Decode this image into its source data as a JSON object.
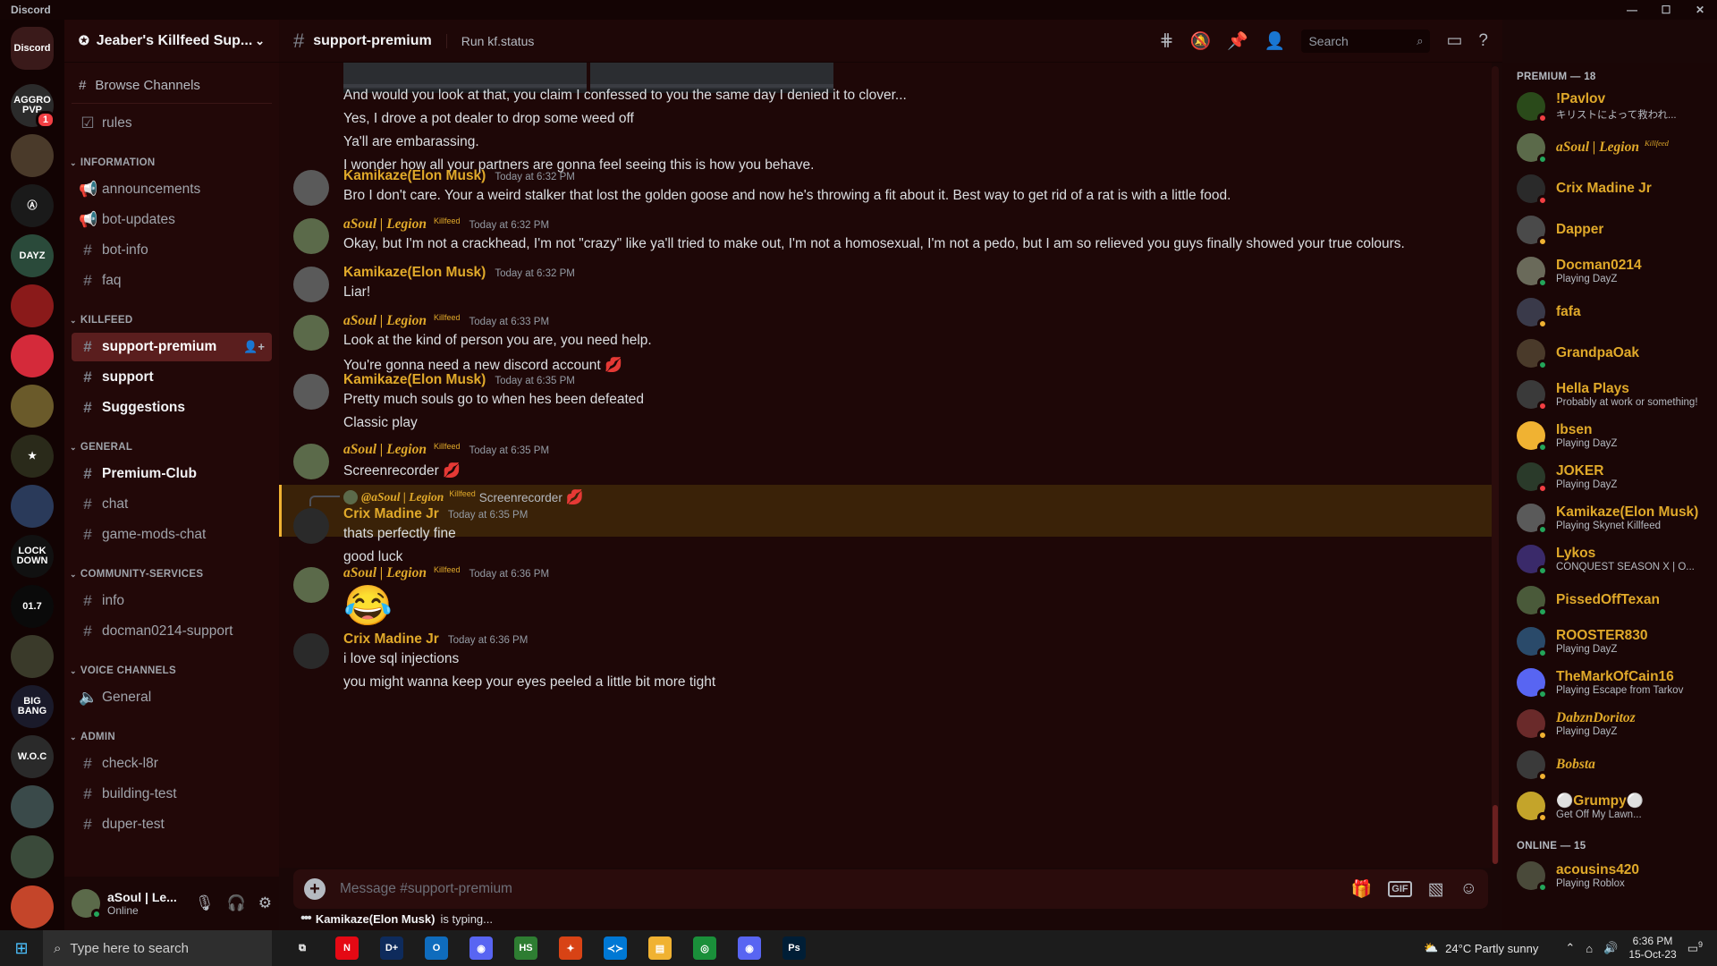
{
  "window": {
    "title": "Discord",
    "controls": [
      "—",
      "☐",
      "✕"
    ]
  },
  "servers": [
    {
      "label": "Discord",
      "color": "#3a1a1a"
    },
    {
      "label": "AGGRO PVP",
      "color": "#2b2b2b",
      "badge": "1"
    },
    {
      "label": "",
      "color": "#4a3a2a"
    },
    {
      "label": "Ⓐ",
      "color": "#1a1a1a"
    },
    {
      "label": "DAYZ",
      "color": "#2a4a3a"
    },
    {
      "label": "",
      "color": "#8a1a1a"
    },
    {
      "label": "",
      "color": "#d42a3a"
    },
    {
      "label": "",
      "color": "#6a5a2a"
    },
    {
      "label": "★",
      "color": "#2a2a1a"
    },
    {
      "label": "",
      "color": "#2a3a5a"
    },
    {
      "label": "LOCK DOWN",
      "color": "#111111"
    },
    {
      "label": "01.7",
      "color": "#0a0a0a"
    },
    {
      "label": "",
      "color": "#3a3a2a"
    },
    {
      "label": "BIG BANG",
      "color": "#1a1a2a"
    },
    {
      "label": "W.O.C",
      "color": "#2a2a2a"
    },
    {
      "label": "",
      "color": "#3a4a4a"
    },
    {
      "label": "",
      "color": "#3a4a3a"
    },
    {
      "label": "",
      "color": "#c4452a"
    }
  ],
  "server": {
    "name": "Jeaber's Killfeed Sup...",
    "browse": "Browse Channels"
  },
  "channels": {
    "top": [
      {
        "name": "rules",
        "icon": "☑"
      }
    ],
    "categories": [
      {
        "name": "INFORMATION",
        "items": [
          {
            "name": "announcements",
            "icon": "📢",
            "state": "normal"
          },
          {
            "name": "bot-updates",
            "icon": "📢",
            "state": "normal"
          },
          {
            "name": "bot-info",
            "icon": "#",
            "state": "normal"
          },
          {
            "name": "faq",
            "icon": "#",
            "state": "normal"
          }
        ]
      },
      {
        "name": "KILLFEED",
        "items": [
          {
            "name": "support-premium",
            "icon": "#",
            "state": "active"
          },
          {
            "name": "support",
            "icon": "#",
            "state": "unread"
          },
          {
            "name": "Suggestions",
            "icon": "#",
            "state": "unread"
          }
        ]
      },
      {
        "name": "GENERAL",
        "items": [
          {
            "name": "Premium-Club",
            "icon": "#",
            "state": "unread"
          },
          {
            "name": "chat",
            "icon": "#",
            "state": "normal"
          },
          {
            "name": "game-mods-chat",
            "icon": "#",
            "state": "normal"
          }
        ]
      },
      {
        "name": "COMMUNITY-SERVICES",
        "items": [
          {
            "name": "info",
            "icon": "#",
            "state": "normal"
          },
          {
            "name": "docman0214-support",
            "icon": "#",
            "state": "normal"
          }
        ]
      },
      {
        "name": "VOICE CHANNELS",
        "items": [
          {
            "name": "General",
            "icon": "🔈",
            "state": "normal"
          }
        ]
      },
      {
        "name": "ADMIN",
        "items": [
          {
            "name": "check-l8r",
            "icon": "#",
            "state": "normal"
          },
          {
            "name": "building-test",
            "icon": "#",
            "state": "normal"
          },
          {
            "name": "duper-test",
            "icon": "#",
            "state": "normal"
          }
        ]
      }
    ]
  },
  "user": {
    "name": "aSoul | Le...",
    "status": "Online"
  },
  "header": {
    "channel": "support-premium",
    "topic": "Run kf.status",
    "search_placeholder": "Search"
  },
  "messages": [
    {
      "type": "cont",
      "lines": [
        "And would you look at that, you claim I confessed to you the same day I denied it to clover...",
        "Yes, I drove a pot dealer to drop some weed off",
        "Ya'll are embarassing.",
        "I wonder how all your partners are gonna feel seeing this is how you behave."
      ]
    },
    {
      "type": "msg",
      "user": "Kamikaze(Elon Musk)",
      "tag": "",
      "time": "Today at 6:32 PM",
      "lines": [
        "Bro I don't care. Your a weird stalker that lost the golden goose and now he's throwing a fit about it. Best way to get rid of a rat is with a little food."
      ]
    },
    {
      "type": "msg",
      "user": "aSoul | Legion",
      "tag": "Killfeed",
      "time": "Today at 6:32 PM",
      "lines": [
        "Okay, but I'm not a crackhead, I'm not \"crazy\" like ya'll tried to make out, I'm not a homosexual, I'm not a pedo, but I am so relieved you guys finally showed your true colours."
      ]
    },
    {
      "type": "msg",
      "user": "Kamikaze(Elon Musk)",
      "tag": "",
      "time": "Today at 6:32 PM",
      "lines": [
        "Liar!"
      ]
    },
    {
      "type": "msg",
      "user": "aSoul | Legion",
      "tag": "Killfeed",
      "time": "Today at 6:33 PM",
      "lines": [
        "Look at the kind of person you are, you need help.",
        "You're gonna need a new discord account"
      ]
    },
    {
      "type": "msg",
      "user": "Kamikaze(Elon Musk)",
      "tag": "",
      "time": "Today at 6:35 PM",
      "lines": [
        "Pretty much souls go to when hes been defeated",
        "Classic play"
      ]
    },
    {
      "type": "msg",
      "user": "aSoul | Legion",
      "tag": "Killfeed",
      "time": "Today at 6:35 PM",
      "lines": [
        "Screenrecorder"
      ]
    },
    {
      "type": "reply",
      "reply_user": "@aSoul | Legion",
      "reply_tag": "Killfeed",
      "reply_text": "Screenrecorder",
      "user": "Crix Madine Jr",
      "time": "Today at 6:35 PM",
      "lines": [
        "thats perfectly fine",
        "good luck"
      ]
    },
    {
      "type": "msg",
      "user": "aSoul | Legion",
      "tag": "Killfeed",
      "time": "Today at 6:36 PM",
      "lines": [
        "😂"
      ]
    },
    {
      "type": "msg",
      "user": "Crix Madine Jr",
      "tag": "",
      "time": "Today at 6:36 PM",
      "lines": [
        "i love sql injections",
        "you might wanna keep your eyes peeled a little bit more tight"
      ]
    }
  ],
  "composer": {
    "placeholder": "Message #support-premium",
    "gif": "GIF"
  },
  "typing": {
    "user": "Kamikaze(Elon Musk)",
    "text": "is typing..."
  },
  "members": {
    "premium_header": "PREMIUM — 18",
    "online_header": "ONLINE — 15",
    "premium": [
      {
        "name": "!Pavlov",
        "activity": "キリストによって救われ...",
        "status": "dnd",
        "color": "#2a4a1a"
      },
      {
        "name": "aSoul | Legion",
        "tag": "Killfeed",
        "activity": "",
        "status": "online",
        "color": "#5b6a4a"
      },
      {
        "name": "Crix Madine Jr",
        "activity": "",
        "status": "dnd",
        "color": "#2a2a2a"
      },
      {
        "name": "Dapper",
        "activity": "",
        "status": "idle",
        "color": "#4a4a4a"
      },
      {
        "name": "Docman0214",
        "activity": "Playing DayZ",
        "status": "online",
        "color": "#6a6a5a"
      },
      {
        "name": "fafa",
        "activity": "",
        "status": "idle",
        "color": "#3a3a4a"
      },
      {
        "name": "GrandpaOak",
        "activity": "",
        "status": "online",
        "color": "#4a3a2a"
      },
      {
        "name": "Hella Plays",
        "activity": "Probably at work or something!",
        "status": "dnd",
        "color": "#3a3a3a"
      },
      {
        "name": "Ibsen",
        "activity": "Playing DayZ",
        "status": "online",
        "color": "#f0b232"
      },
      {
        "name": "JOKER",
        "activity": "Playing DayZ",
        "status": "dnd",
        "color": "#2a3a2a"
      },
      {
        "name": "Kamikaze(Elon Musk)",
        "activity": "Playing Skynet Killfeed",
        "status": "online",
        "color": "#5a5a5a"
      },
      {
        "name": "Lykos",
        "activity": "CONQUEST SEASON X | O...",
        "status": "online",
        "color": "#3a2a6a"
      },
      {
        "name": "PissedOffTexan",
        "activity": "",
        "status": "online",
        "color": "#4a5a3a"
      },
      {
        "name": "ROOSTER830",
        "activity": "Playing DayZ",
        "status": "online",
        "color": "#2a4a6a"
      },
      {
        "name": "TheMarkOfCain16",
        "activity": "Playing Escape from Tarkov",
        "status": "online",
        "color": "#5865f2"
      },
      {
        "name": "DabznDoritoz",
        "activity": "Playing DayZ",
        "status": "idle",
        "color": "#6a2a2a"
      },
      {
        "name": "Bobsta",
        "activity": "",
        "status": "idle",
        "color": "#3a3a3a"
      },
      {
        "name": "⚪Grumpy⚪",
        "activity": "Get Off My Lawn...",
        "status": "idle",
        "color": "#c4a42a"
      }
    ],
    "online": [
      {
        "name": "acousins420",
        "activity": "Playing Roblox",
        "status": "online",
        "color": "#4a4a3a"
      }
    ]
  },
  "taskbar": {
    "search_placeholder": "Type here to search",
    "apps": [
      {
        "label": "⧉",
        "color": "transparent"
      },
      {
        "label": "N",
        "color": "#e50914"
      },
      {
        "label": "D+",
        "color": "#0e2b5c"
      },
      {
        "label": "O",
        "color": "#0f6cbd"
      },
      {
        "label": "◉",
        "color": "#5865f2"
      },
      {
        "label": "HS",
        "color": "#2e7d32"
      },
      {
        "label": "✦",
        "color": "#d84315"
      },
      {
        "label": "≺≻",
        "color": "#0078d4"
      },
      {
        "label": "▤",
        "color": "#f0b232"
      },
      {
        "label": "◎",
        "color": "#1a8f3a"
      },
      {
        "label": "◉",
        "color": "#5865f2"
      },
      {
        "label": "Ps",
        "color": "#001e36"
      }
    ],
    "weather": "24°C  Partly sunny",
    "time": "6:36 PM",
    "date": "15-Oct-23",
    "notifications": "9"
  }
}
